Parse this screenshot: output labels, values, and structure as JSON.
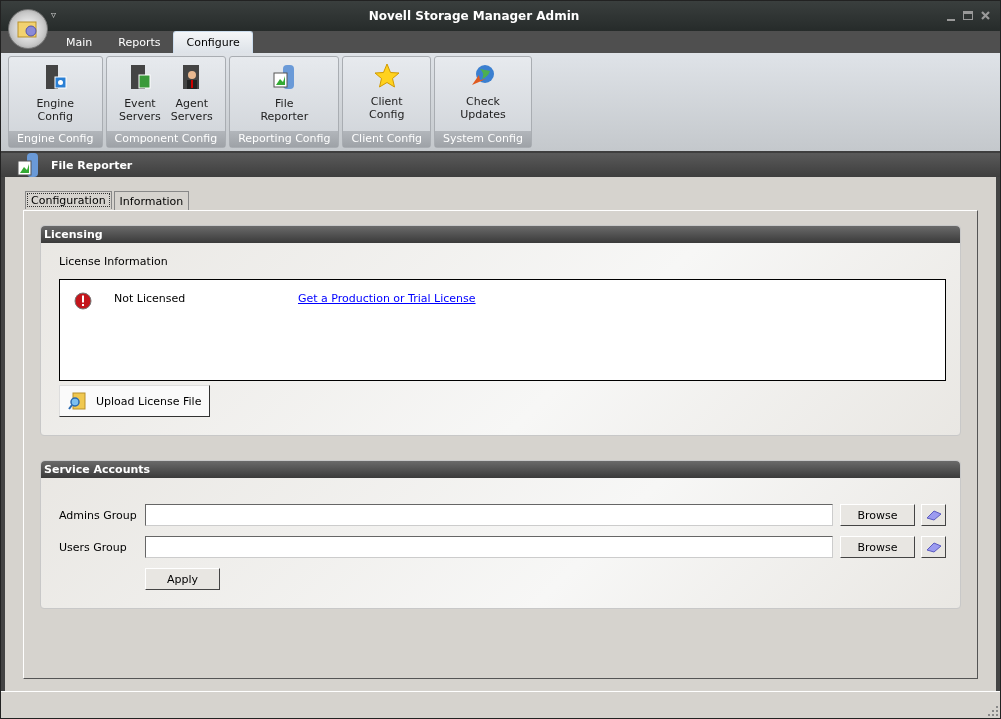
{
  "window": {
    "title": "Novell Storage Manager Admin",
    "menu_glyph": "▿"
  },
  "ribbon_tabs": [
    {
      "label": "Main",
      "selected": false
    },
    {
      "label": "Reports",
      "selected": false
    },
    {
      "label": "Configure",
      "selected": true
    }
  ],
  "ribbon_groups": [
    {
      "label": "Engine Config",
      "buttons": [
        {
          "label": "Engine Config",
          "kind": "engine"
        }
      ]
    },
    {
      "label": "Component Config",
      "buttons": [
        {
          "label": "Event Servers",
          "kind": "event"
        },
        {
          "label": "Agent Servers",
          "kind": "agent"
        }
      ]
    },
    {
      "label": "Reporting Config",
      "buttons": [
        {
          "label": "File Reporter",
          "kind": "report"
        }
      ]
    },
    {
      "label": "Client Config",
      "buttons": [
        {
          "label": "Client Config",
          "kind": "star"
        }
      ]
    },
    {
      "label": "System Config",
      "buttons": [
        {
          "label": "Check Updates",
          "kind": "globe"
        }
      ]
    }
  ],
  "page_header": {
    "title": "File Reporter"
  },
  "content_tabs": [
    {
      "label": "Configuration",
      "selected": true
    },
    {
      "label": "Information",
      "selected": false
    }
  ],
  "licensing": {
    "title": "Licensing",
    "subtitle": "License Information",
    "status": "Not Licensed",
    "link": "Get a Production or Trial License",
    "upload_button": "Upload License File"
  },
  "service_accounts": {
    "title": "Service Accounts",
    "fields": [
      {
        "label": "Admins Group",
        "browse": "Browse"
      },
      {
        "label": "Users Group",
        "browse": "Browse"
      }
    ],
    "apply": "Apply"
  }
}
